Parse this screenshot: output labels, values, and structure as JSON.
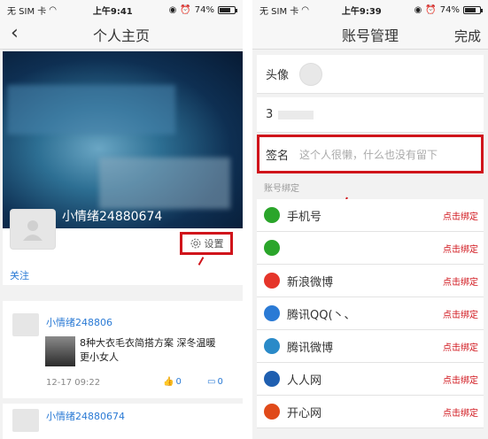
{
  "left": {
    "status": {
      "carrier": "无 SIM 卡",
      "time": "上午9:41",
      "battery": "74%",
      "battery_level": 0.74
    },
    "nav": {
      "title": "个人主页"
    },
    "profile": {
      "username": "小情绪24880674",
      "follow": "关注",
      "settings": "设置"
    },
    "feed": [
      {
        "user": "小情绪248806",
        "title1": "8种大衣毛衣简搭方案 深冬温暖",
        "title2": "更小女人",
        "date": "12-17 09:22",
        "likes": "0",
        "comments": "0"
      },
      {
        "user": "小情绪24880674"
      }
    ]
  },
  "right": {
    "status": {
      "carrier": "无 SIM 卡",
      "time": "上午9:39",
      "battery": "74%",
      "battery_level": 0.74
    },
    "nav": {
      "title": "账号管理",
      "done": "完成"
    },
    "avatar_label": "头像",
    "nickname_initial": "3",
    "signature": {
      "label": "签名",
      "placeholder": "这个人很懒，什么也没有留下"
    },
    "section_title": "账号绑定",
    "bind_action": "点击绑定",
    "bindings": [
      {
        "label": "手机号",
        "icon": "phone-icon",
        "color": "#2aa52a"
      },
      {
        "label": "",
        "icon": "green-icon",
        "color": "#2aa52a"
      },
      {
        "label": "新浪微博",
        "icon": "weibo-icon",
        "color": "#e5352a"
      },
      {
        "label": "腾讯QQ(丶、",
        "icon": "qq-icon",
        "color": "#2a7ad5"
      },
      {
        "label": "腾讯微博",
        "icon": "tencent-weibo-icon",
        "color": "#2a8ac8"
      },
      {
        "label": "人人网",
        "icon": "renren-icon",
        "color": "#1f5fb0"
      },
      {
        "label": "开心网",
        "icon": "kaixin-icon",
        "color": "#e04a1a"
      }
    ]
  },
  "colors": {
    "highlight": "#d0141b",
    "link": "#2a7ad5"
  }
}
